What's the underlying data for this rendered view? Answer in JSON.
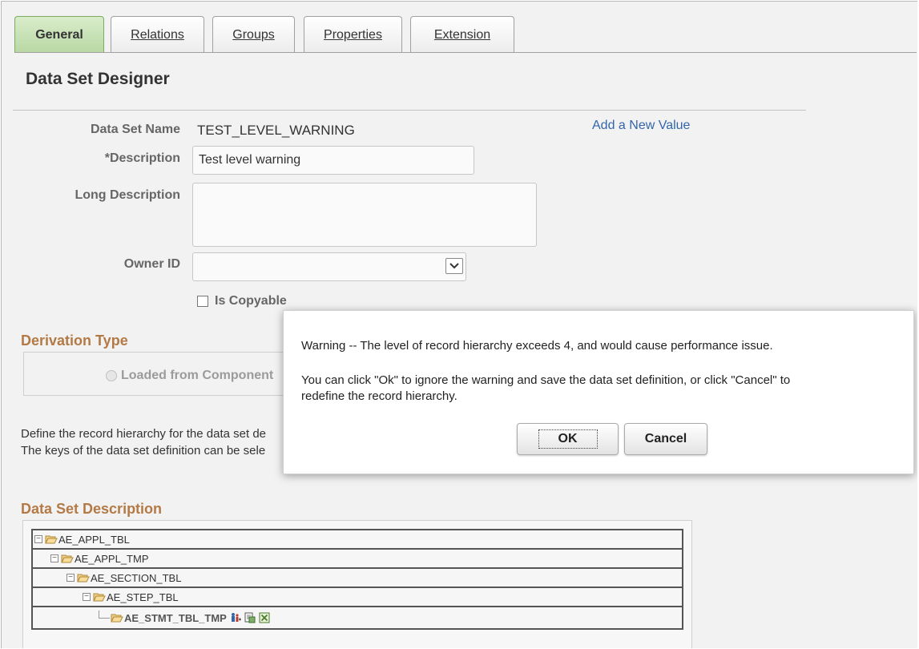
{
  "tabs": [
    {
      "label": "General",
      "active": true
    },
    {
      "label": "Relations",
      "active": false
    },
    {
      "label": "Groups",
      "active": false
    },
    {
      "label": "Properties",
      "active": false
    },
    {
      "label": "Extension",
      "active": false
    }
  ],
  "page_title": "Data Set Designer",
  "form": {
    "data_set_name_label": "Data Set Name",
    "data_set_name_value": "TEST_LEVEL_WARNING",
    "add_new_value_link": "Add a New Value",
    "description_label": "*Description",
    "description_value": "Test level warning",
    "long_description_label": "Long Description",
    "long_description_value": "",
    "owner_id_label": "Owner ID",
    "owner_id_value": "",
    "is_copyable_label": "Is Copyable",
    "is_copyable_checked": false
  },
  "derivation": {
    "heading": "Derivation Type",
    "option_label": "Loaded from Component"
  },
  "instructions": {
    "line1": "Define the record hierarchy for the data set de",
    "line2": "The keys of the data set definition can be sele"
  },
  "tree": {
    "heading": "Data Set Description",
    "nodes": [
      {
        "label": "AE_APPL_TBL",
        "depth": 0
      },
      {
        "label": "AE_APPL_TMP",
        "depth": 1
      },
      {
        "label": "AE_SECTION_TBL",
        "depth": 2
      },
      {
        "label": "AE_STEP_TBL",
        "depth": 3
      },
      {
        "label": "AE_STMT_TBL_TMP",
        "depth": 4
      }
    ]
  },
  "modal": {
    "warning": "Warning -- The level of record hierarchy exceeds 4, and would cause performance issue.",
    "info_line1": "You can click \"Ok\" to ignore the warning and save the data set definition, or click \"Cancel\" to",
    "info_line2": "redefine the record hierarchy.",
    "ok_label": "OK",
    "cancel_label": "Cancel"
  },
  "colors": {
    "active_tab": "#c6e0b4",
    "section_heading": "#b47a45",
    "link": "#3366aa"
  }
}
